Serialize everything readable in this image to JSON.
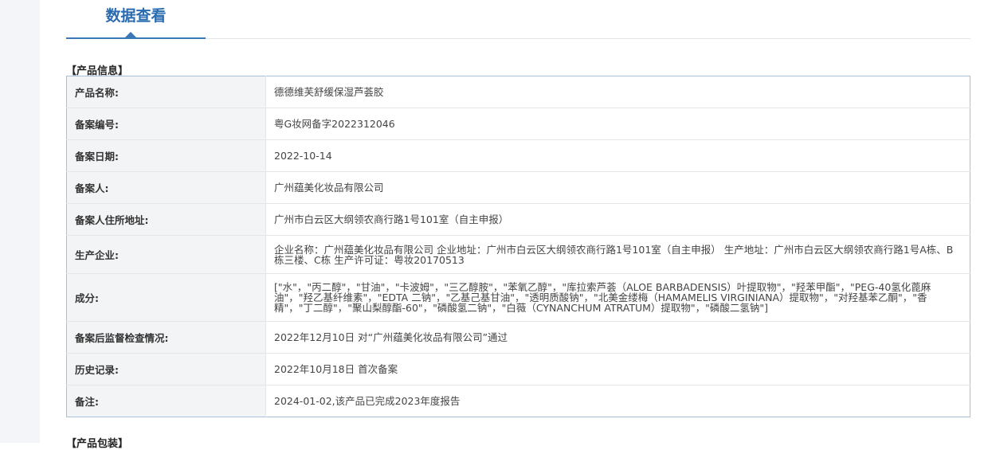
{
  "tab": {
    "title": "数据查看"
  },
  "sections": {
    "product_info": "【产品信息】",
    "product_packaging": "【产品包装】"
  },
  "rows": [
    {
      "label": "产品名称:",
      "value": "德德维芙舒缓保湿芦荟胶"
    },
    {
      "label": "备案编号:",
      "value": "粤G妆网备字2022312046"
    },
    {
      "label": "备案日期:",
      "value": "2022-10-14"
    },
    {
      "label": "备案人:",
      "value": "广州蕴美化妆品有限公司"
    },
    {
      "label": "备案人住所地址:",
      "value": "广州市白云区大纲领农商行路1号101室（自主申报）"
    },
    {
      "label": "生产企业:",
      "value": "企业名称：广州蕴美化妆品有限公司 企业地址：广州市白云区大纲领农商行路1号101室（自主申报） 生产地址：广州市白云区大纲领农商行路1号A栋、B栋三楼、C栋 生产许可证：粤妆20170513"
    },
    {
      "label": "成分:",
      "value": "[\"水\"，\"丙二醇\"，\"甘油\"，\"卡波姆\"，\"三乙醇胺\"，\"苯氧乙醇\"，\"库拉索芦荟（ALOE BARBADENSIS）叶提取物\"，\"羟苯甲酯\"，\"PEG-40氢化蓖麻油\"，\"羟乙基纤维素\"，\"EDTA 二钠\"，\"乙基己基甘油\"，\"透明质酸钠\"，\"北美金缕梅（HAMAMELIS VIRGINIANA）提取物\"，\"对羟基苯乙酮\"，\"香精\"，\"丁二醇\"，\"聚山梨醇酯-60\"，\"磷酸氢二钠\"，\"白薇（CYNANCHUM ATRATUM）提取物\"，\"磷酸二氢钠\"]"
    },
    {
      "label": "备案后监督检查情况:",
      "value": "2022年12月10日 对“广州蕴美化妆品有限公司”通过"
    },
    {
      "label": "历史记录:",
      "value": "2022年10月18日 首次备案"
    },
    {
      "label": "备注:",
      "value": "2024-01-02,该产品已完成2023年度报告"
    }
  ]
}
